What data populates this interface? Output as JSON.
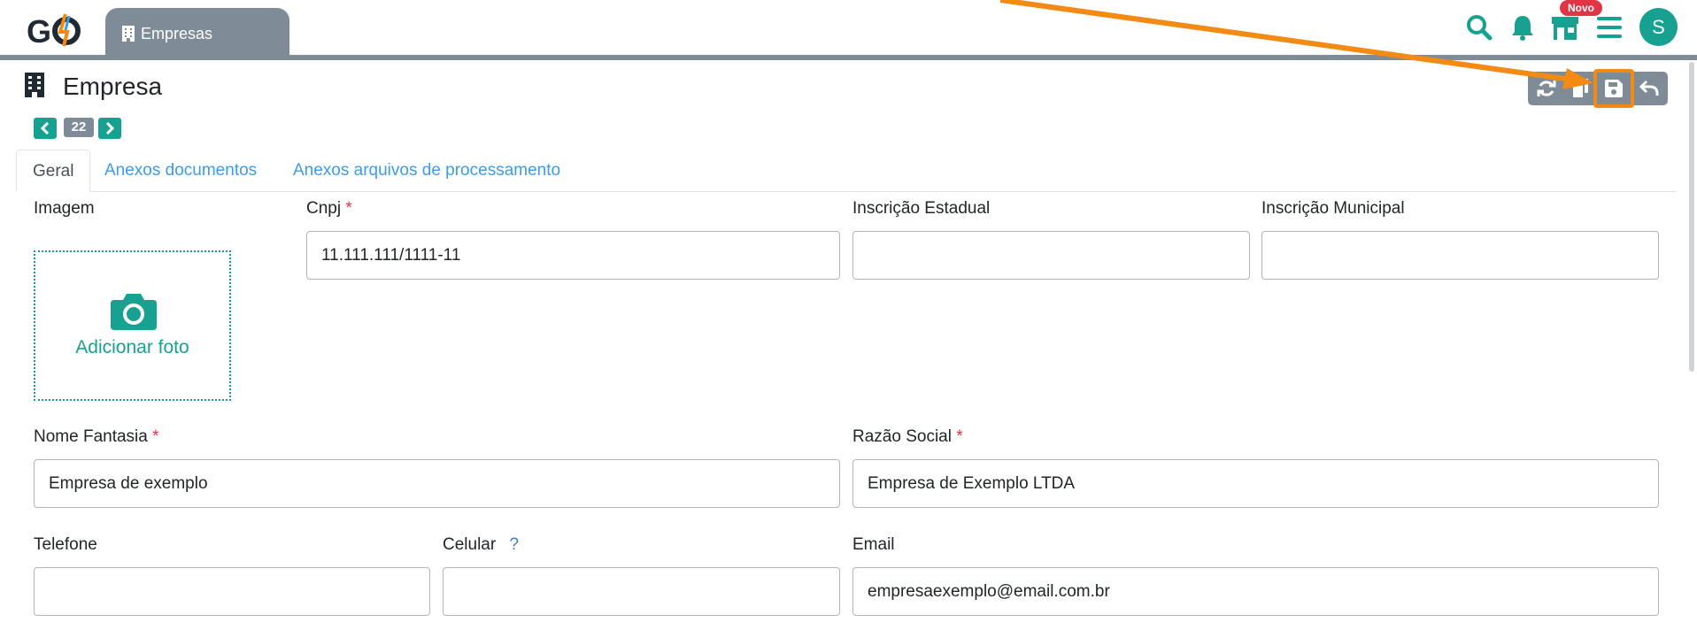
{
  "topbar": {
    "tab_label": "Empresas",
    "badge": "Novo",
    "avatar_initial": "S",
    "accent_color": "#17a191"
  },
  "page": {
    "title": "Empresa",
    "record_number": "22"
  },
  "tabs": [
    {
      "label": "Geral",
      "active": true
    },
    {
      "label": "Anexos documentos",
      "active": false
    },
    {
      "label": "Anexos arquivos de processamento",
      "active": false
    }
  ],
  "form": {
    "image_label": "Imagem",
    "add_photo": "Adicionar foto",
    "cnpj": {
      "label": "Cnpj",
      "required": "*",
      "value": "11.111.111/1111-11"
    },
    "inscricao_estadual": {
      "label": "Inscrição Estadual",
      "value": ""
    },
    "inscricao_municipal": {
      "label": "Inscrição Municipal",
      "value": ""
    },
    "nome_fantasia": {
      "label": "Nome Fantasia",
      "required": "*",
      "value": "Empresa de exemplo"
    },
    "razao_social": {
      "label": "Razão Social",
      "required": "*",
      "value": "Empresa de Exemplo LTDA"
    },
    "telefone": {
      "label": "Telefone",
      "value": ""
    },
    "celular": {
      "label": "Celular",
      "help": "?",
      "value": ""
    },
    "email": {
      "label": "Email",
      "value": "empresaexemplo@email.com.br"
    }
  },
  "icons": {
    "search": "search-icon",
    "bell": "bell-icon",
    "store": "store-icon",
    "menu": "menu-icon",
    "refresh": "refresh-icon",
    "copy": "copy-icon",
    "save": "save-icon",
    "undo": "undo-icon"
  }
}
